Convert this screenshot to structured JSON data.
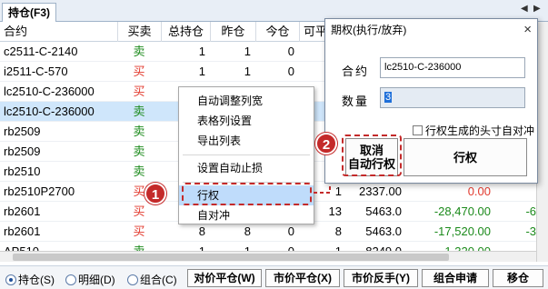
{
  "tab": {
    "label": "持仓(F3)"
  },
  "tabnav": {
    "left": "◀",
    "right": "▶"
  },
  "columns": [
    "合约",
    "买卖",
    "总持仓",
    "昨仓",
    "今仓",
    "可平"
  ],
  "rows": [
    {
      "name": "c2511-C-2140",
      "dir": "卖",
      "side": "sell",
      "total": "1",
      "yesterday": "1",
      "today": "0",
      "avg": "",
      "pl": "",
      "extra": ""
    },
    {
      "name": "i2511-C-570",
      "dir": "买",
      "side": "buy",
      "total": "1",
      "yesterday": "1",
      "today": "0",
      "avg": "",
      "pl": "",
      "extra": ""
    },
    {
      "name": "lc2510-C-236000",
      "dir": "买",
      "side": "buy",
      "total": "",
      "yesterday": "",
      "today": "",
      "avg": "",
      "pl": "",
      "extra": ""
    },
    {
      "name": "lc2510-C-236000",
      "dir": "卖",
      "side": "sell",
      "total": "",
      "yesterday": "",
      "today": "",
      "avg": "",
      "pl": "",
      "extra": ""
    },
    {
      "name": "rb2509",
      "dir": "卖",
      "side": "sell",
      "total": "",
      "yesterday": "",
      "today": "",
      "avg": "",
      "pl": "",
      "extra": ""
    },
    {
      "name": "rb2509",
      "dir": "卖",
      "side": "sell",
      "total": "",
      "yesterday": "",
      "today": "",
      "avg": "",
      "pl": "",
      "extra": ""
    },
    {
      "name": "rb2510",
      "dir": "卖",
      "side": "sell",
      "total": "",
      "yesterday": "",
      "today": "",
      "avg": "",
      "pl": "",
      "extra": ""
    },
    {
      "name": "rb2510P2700",
      "dir": "买",
      "side": "buy",
      "total": "",
      "yesterday": "",
      "today": "",
      "avail": "1",
      "avg": "2337.00",
      "pl": "0.00",
      "plclass": "zero",
      "extra": ""
    },
    {
      "name": "rb2601",
      "dir": "买",
      "side": "buy",
      "total": "",
      "yesterday": "",
      "today": "",
      "avail": "13",
      "avg": "5463.0",
      "pl": "-28,470.00",
      "plclass": "neg",
      "extra": "-6"
    },
    {
      "name": "rb2601",
      "dir": "买",
      "side": "buy",
      "total": "8",
      "yesterday": "8",
      "today": "0",
      "avail": "8",
      "avg": "5463.0",
      "pl": "-17,520.00",
      "plclass": "neg",
      "extra": "-3"
    },
    {
      "name": "AP510",
      "dir": "卖",
      "side": "sell",
      "total": "1",
      "yesterday": "1",
      "today": "0",
      "avail": "1",
      "avg": "8249.0",
      "pl": "-1,320.00",
      "plclass": "neg",
      "extra": ""
    }
  ],
  "menu": {
    "items": [
      "自动调整列宽",
      "表格列设置",
      "导出列表",
      "设置自动止损",
      "行权",
      "自对冲"
    ]
  },
  "dialog": {
    "title": "期权(执行/放弃)",
    "close": "×",
    "contract_label": "合约",
    "contract_value": "lc2510-C-236000",
    "qty_label": "数量",
    "qty_value": "3",
    "checkbox_label": "行权生成的头寸自对冲",
    "cancel_exercise_label": "取消\n自动行权",
    "exercise_label": "行权"
  },
  "bottom": {
    "radios": [
      "持仓(S)",
      "明细(D)",
      "组合(C)"
    ],
    "buttons": [
      "对价平仓(W)",
      "市价平仓(X)",
      "市价反手(Y)",
      "组合申请",
      "移仓"
    ]
  },
  "callouts": [
    "1",
    "2"
  ],
  "colors": {
    "buy": "#e23a2e",
    "sell": "#1b8a1b",
    "accent": "#c42a2a",
    "selected_row": "#cfe6fb",
    "menu_highlight": "#bfdcfb"
  }
}
